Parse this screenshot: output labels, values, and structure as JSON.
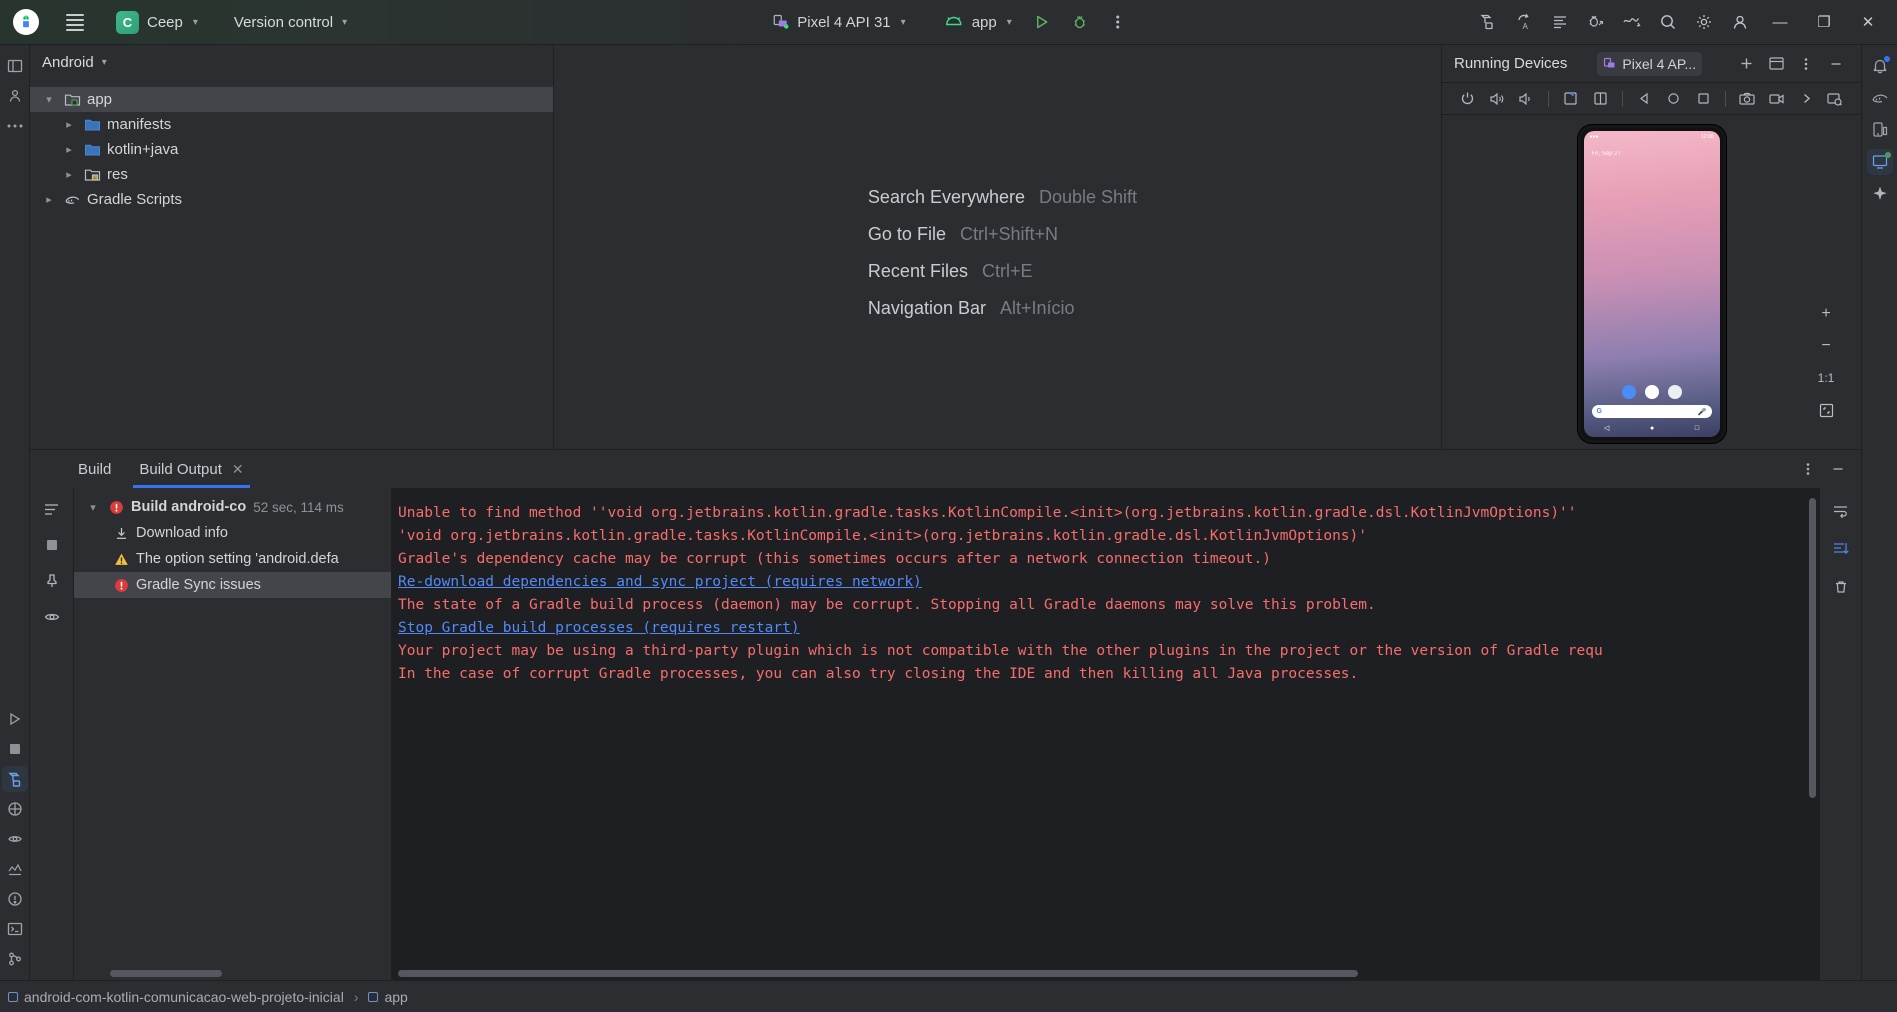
{
  "titlebar": {
    "app_icon": "android-studio-icon",
    "menu_icon": "hamburger-menu-icon",
    "project_initial": "C",
    "project_name": "Ceep",
    "vcs_label": "Version control",
    "device_label": "Pixel 4 API 31",
    "module_label": "app",
    "run_icon": "run-icon",
    "debug_icon": "debug-icon",
    "more_icon": "more-vertical-icon",
    "right_icons": [
      "build-icon",
      "apply-changes-icon",
      "code-with-me-icon",
      "attach-debugger-icon",
      "profiler-icon",
      "search-icon",
      "settings-icon",
      "account-icon"
    ],
    "window_minimize": "—",
    "window_maximize": "❐",
    "window_close": "✕"
  },
  "left_rail": {
    "items": [
      {
        "name": "project-icon",
        "active": false
      },
      {
        "name": "commit-icon",
        "active": false
      },
      {
        "name": "more-tool-windows-icon",
        "active": false
      }
    ],
    "bottom_items": [
      {
        "name": "run-tool-icon"
      },
      {
        "name": "stop-icon"
      },
      {
        "name": "build-tool-icon",
        "active": true
      },
      {
        "name": "bookmarks-icon"
      },
      {
        "name": "preview-icon"
      },
      {
        "name": "app-quality-icon"
      },
      {
        "name": "app-inspection-icon"
      },
      {
        "name": "problems-icon"
      },
      {
        "name": "terminal-icon"
      },
      {
        "name": "version-control-icon"
      }
    ]
  },
  "project_panel": {
    "view_label": "Android",
    "view_chevron": "chevron-down-icon",
    "tree": [
      {
        "label": "app",
        "level": 0,
        "expanded": true,
        "selected": true,
        "icon": "module-folder-icon",
        "twisty": "chevron-down-icon"
      },
      {
        "label": "manifests",
        "level": 1,
        "expanded": false,
        "selected": false,
        "icon": "folder-icon",
        "twisty": "chevron-right-icon"
      },
      {
        "label": "kotlin+java",
        "level": 1,
        "expanded": false,
        "selected": false,
        "icon": "folder-icon",
        "twisty": "chevron-right-icon"
      },
      {
        "label": "res",
        "level": 1,
        "expanded": false,
        "selected": false,
        "icon": "res-folder-icon",
        "twisty": "chevron-right-icon"
      },
      {
        "label": "Gradle Scripts",
        "level": 0,
        "expanded": false,
        "selected": false,
        "icon": "gradle-icon",
        "twisty": "chevron-right-icon"
      }
    ]
  },
  "editor_shortcuts": [
    {
      "name": "Search Everywhere",
      "key": "Double Shift"
    },
    {
      "name": "Go to File",
      "key": "Ctrl+Shift+N"
    },
    {
      "name": "Recent Files",
      "key": "Ctrl+E"
    },
    {
      "name": "Navigation Bar",
      "key": "Alt+Início"
    }
  ],
  "devices_panel": {
    "title": "Running Devices",
    "tab_label": "Pixel 4 AP...",
    "tab_icon": "device-icon",
    "add_icon": "plus-icon",
    "layout_icon": "split-layout-icon",
    "options_icon": "more-vertical-icon",
    "minimize_icon": "minimize-icon",
    "toolbar_icons": [
      "power-icon",
      "volume-up-icon",
      "volume-down-icon",
      "rotate-left-icon",
      "rotate-right-icon",
      "back-icon",
      "home-icon",
      "overview-icon",
      "screenshot-icon",
      "record-icon",
      "chevron-right-icon",
      "device-settings-icon"
    ],
    "phone": {
      "status_time": "12:00",
      "date_widget": "Fri, Sep 27",
      "apps": [
        "messages-app-icon",
        "play-store-app-icon",
        "chrome-app-icon"
      ],
      "search_left_icon": "google-g-icon",
      "search_right_icon": "microphone-icon",
      "nav_back": "◁",
      "nav_home": "●",
      "nav_recents": "□"
    },
    "zoom_tools": {
      "zoom_in": "+",
      "zoom_out": "−",
      "actual_size": "1:1",
      "fit_screen": "fit-screen-icon"
    }
  },
  "build_panel": {
    "tabs": [
      {
        "label": "Build",
        "active": false,
        "closable": false
      },
      {
        "label": "Build Output",
        "active": true,
        "closable": true,
        "close_icon": "close-icon"
      }
    ],
    "header_icons": [
      "more-vertical-icon",
      "minimize-icon"
    ],
    "rail_icons": [
      "filter-icon",
      "restart-icon",
      "pin-icon",
      "settings-eye-icon"
    ],
    "right_rail_icons": [
      "soft-wrap-icon",
      "scroll-to-end-icon",
      "clear-all-icon"
    ],
    "tree": [
      {
        "label": "Build android-co",
        "time": "52 sec, 114 ms",
        "level": 0,
        "status": "error",
        "icon": "error-icon",
        "selected": false,
        "bold": true,
        "twisty": "chevron-down-icon"
      },
      {
        "label": "Download info",
        "time": "",
        "level": 1,
        "status": "info",
        "icon": "download-icon",
        "selected": false,
        "bold": false,
        "twisty": ""
      },
      {
        "label": "The option setting 'android.defa",
        "time": "",
        "level": 1,
        "status": "warning",
        "icon": "warning-icon",
        "selected": false,
        "bold": false,
        "twisty": ""
      },
      {
        "label": "Gradle Sync issues",
        "time": "",
        "level": 1,
        "status": "error",
        "icon": "error-icon",
        "selected": true,
        "bold": false,
        "twisty": ""
      }
    ],
    "console_lines": [
      {
        "text": "Unable to find method ''void org.jetbrains.kotlin.gradle.tasks.KotlinCompile.<init>(org.jetbrains.kotlin.gradle.dsl.KotlinJvmOptions)''",
        "type": "error"
      },
      {
        "text": "'void org.jetbrains.kotlin.gradle.tasks.KotlinCompile.<init>(org.jetbrains.kotlin.gradle.dsl.KotlinJvmOptions)'",
        "type": "error"
      },
      {
        "text": "",
        "type": "blank"
      },
      {
        "text": "Gradle's dependency cache may be corrupt (this sometimes occurs after a network connection timeout.)",
        "type": "error"
      },
      {
        "text": "",
        "type": "blank"
      },
      {
        "text": "Re-download dependencies and sync project (requires network)",
        "type": "link"
      },
      {
        "text": "The state of a Gradle build process (daemon) may be corrupt. Stopping all Gradle daemons may solve this problem.",
        "type": "error"
      },
      {
        "text": "",
        "type": "blank"
      },
      {
        "text": "Stop Gradle build processes (requires restart)",
        "type": "link"
      },
      {
        "text": "Your project may be using a third-party plugin which is not compatible with the other plugins in the project or the version of Gradle requ",
        "type": "error"
      },
      {
        "text": "",
        "type": "blank"
      },
      {
        "text": "In the case of corrupt Gradle processes, you can also try closing the IDE and then killing all Java processes.",
        "type": "error"
      }
    ]
  },
  "right_rail": {
    "items": [
      {
        "name": "notifications-icon",
        "badge": true
      },
      {
        "name": "gradle-icon",
        "badge": false
      },
      {
        "name": "device-manager-icon",
        "badge": false
      },
      {
        "name": "running-devices-icon",
        "badge": true,
        "active": true
      },
      {
        "name": "gemini-icon",
        "badge": false
      }
    ]
  },
  "statusbar": {
    "breadcrumb": [
      {
        "label": "android-com-kotlin-comunicacao-web-projeto-inicial",
        "icon": "module-icon"
      },
      {
        "label": "app",
        "icon": "module-icon"
      }
    ],
    "separator": "›"
  },
  "colors": {
    "background": "#2b2d30",
    "console_bg": "#1e1f22",
    "accent_blue": "#3574f0",
    "link_blue": "#548af7",
    "error_red": "#f76d6d",
    "warning_yellow": "#f0c040",
    "green": "#499c54",
    "selection": "#43454a"
  }
}
